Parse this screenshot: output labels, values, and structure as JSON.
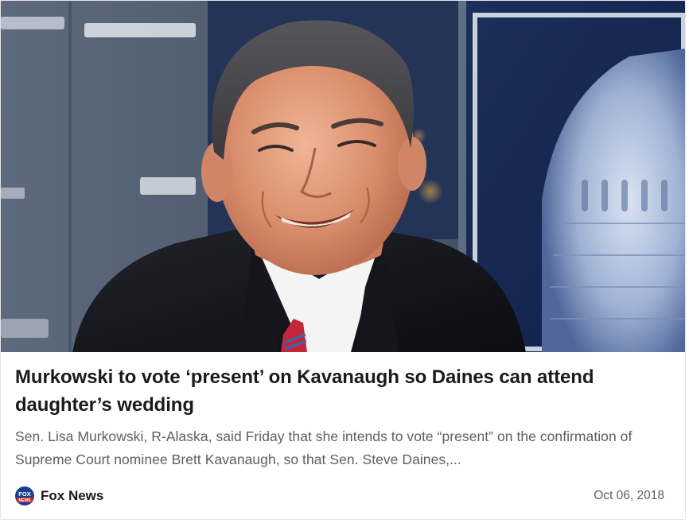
{
  "article": {
    "image_alt": "Steve Daines smiling in a TV studio with the Capitol dome in the background",
    "headline": "Murkowski to vote ‘present’ on Kavanaugh so Daines can attend daughter’s wedding",
    "snippet": "Sen. Lisa Murkowski, R-Alaska, said Friday that she intends to vote “present” on the confirmation of Supreme Court nominee Brett Kavanaugh, so that Sen. Steve Daines,...",
    "source": {
      "name": "Fox News",
      "logo_text_top": "FOX",
      "logo_text_bottom": "NEWS",
      "logo_icon": "fox-news-logo-icon"
    },
    "date": "Oct 06, 2018"
  },
  "colors": {
    "headline": "#1a1a1a",
    "snippet": "#5b5f66",
    "fox_blue": "#1a3f8f",
    "fox_red": "#d62b2b"
  }
}
